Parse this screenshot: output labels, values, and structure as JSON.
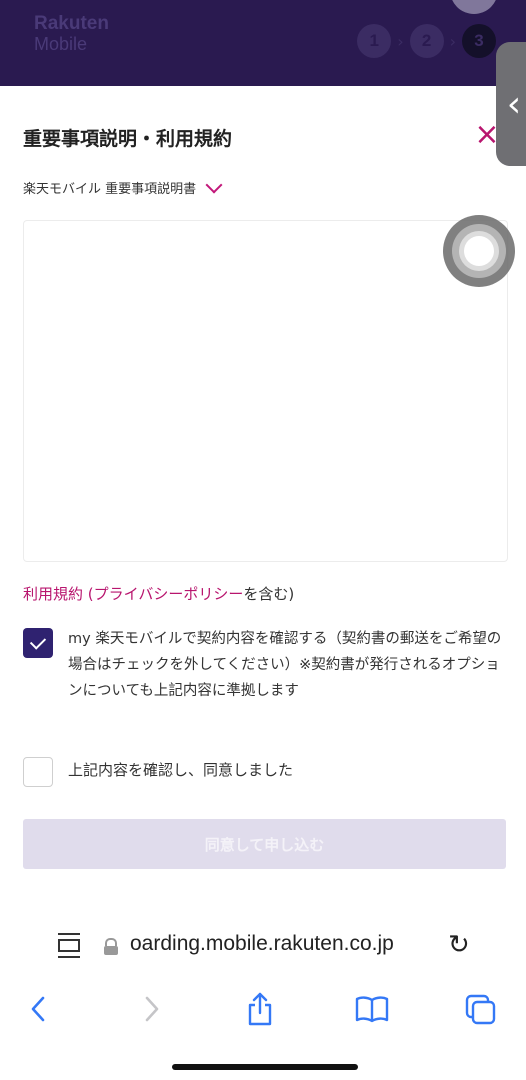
{
  "header": {
    "logo_line1": "Rakuten",
    "logo_line2": "Mobile",
    "steps": [
      "1",
      "2",
      "3"
    ]
  },
  "modal": {
    "title": "重要事項説明・利用規約",
    "close_label": "×",
    "document_select": "楽天モバイル 重要事項説明書",
    "terms_prefix": "利用規約 (",
    "privacy_link": "プライバシーポリシー",
    "terms_suffix": "を含む)",
    "checkbox1_label": "my 楽天モバイルで契約内容を確認する（契約書の郵送をご希望の場合はチェックを外してください）※契約書が発行されるオプションについても上記内容に準拠します",
    "checkbox1_checked": true,
    "checkbox2_label": "上記内容を確認し、同意しました",
    "checkbox2_checked": false,
    "submit_label": "同意して申し込む"
  },
  "browser": {
    "url": "oarding.mobile.rakuten.co.jp"
  },
  "colors": {
    "header_bg": "#2a1a50",
    "accent_pink": "#b8156e",
    "checkbox_purple": "#2f2270",
    "button_disabled": "#e0dcec"
  }
}
